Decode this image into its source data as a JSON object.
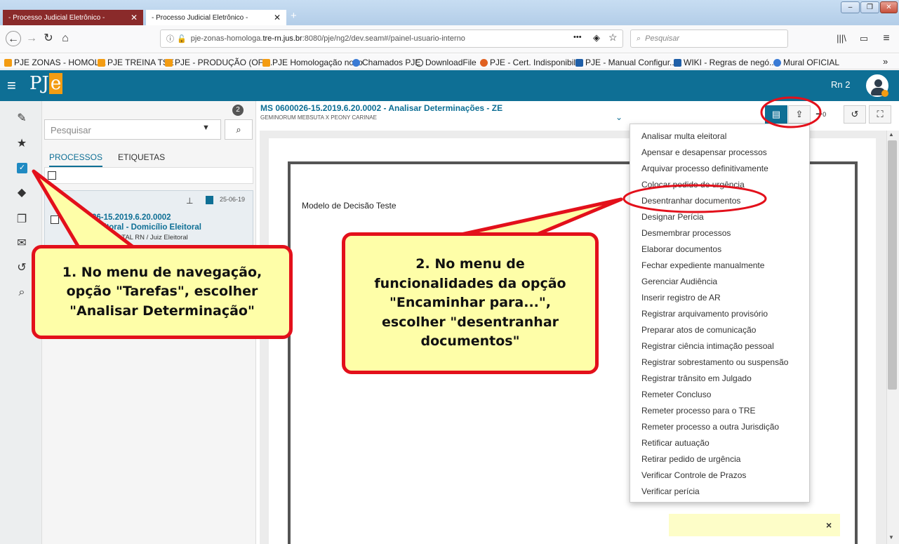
{
  "browser": {
    "tabs": [
      {
        "label": "- Processo Judicial Eletrônico -",
        "active": false
      },
      {
        "label": "- Processo Judicial Eletrônico -",
        "active": true
      }
    ],
    "url_prefix": "pje-zonas-homologa.",
    "url_domain": "tre-rn.jus.br",
    "url_suffix": ":8080/pje/ng2/dev.seam#/painel-usuario-interno",
    "search_placeholder": "Pesquisar",
    "more_dots": "•••",
    "bookmarks": [
      "PJE ZONAS - HOMOL...",
      "PJE TREINA TSE",
      "PJE - PRODUÇÃO (OFI...",
      "PJE Homologação novo",
      "Chamados PJE",
      "DownloadFile",
      "PJE - Cert. Indisponibil...",
      "PJE - Manual Configur...",
      "WIKI - Regras de negó...",
      "Mural OFICIAL"
    ],
    "bookmarks_overflow": "»"
  },
  "app": {
    "logo_pj": "PJ",
    "logo_e": "e",
    "user_name": "Rn 2"
  },
  "process_panel": {
    "badge": "2",
    "search_placeholder": "Pesquisar",
    "tabs": [
      "PROCESSOS",
      "ETIQUETAS"
    ],
    "item": {
      "date": "25-06-19",
      "number": "MS 0600026-15.2019.6.20.0002",
      "number_visible": "26-15.2019.6.20.0002",
      "class_visible": "Eleitoral - Domicílio Eleitoral",
      "orgao_visible": "AL DE NATAL RN / Juiz Eleitoral"
    }
  },
  "task": {
    "title": "MS 0600026-15.2019.6.20.0002 - Analisar Determinações - ZE",
    "subtitle": "GEMINORUM MEBSUTA X PEONY CARINAE",
    "count": "0"
  },
  "document": {
    "text": "Modelo de Decisão Teste",
    "close": "×"
  },
  "menu": {
    "items": [
      "Analisar multa eleitoral",
      "Apensar e desapensar processos",
      "Arquivar processo definitivamente",
      "Colocar pedido de urgência",
      "Desentranhar documentos",
      "Designar Perícia",
      "Desmembrar processos",
      "Elaborar documentos",
      "Fechar expediente manualmente",
      "Gerenciar Audiência",
      "Inserir registro de AR",
      "Registrar arquivamento provisório",
      "Preparar atos de comunicação",
      "Registrar ciência intimação pessoal",
      "Registrar sobrestamento ou suspensão",
      "Registrar trânsito em Julgado",
      "Remeter Concluso",
      "Remeter processo para o TRE",
      "Remeter processo a outra Jurisdição",
      "Retificar autuação",
      "Retirar pedido de urgência",
      "Verificar Controle de Prazos",
      "Verificar perícia"
    ]
  },
  "callouts": {
    "one": [
      "1. No menu de navegação,",
      "opção \"Tarefas\", escolher",
      "\"Analisar Determinação\""
    ],
    "two": [
      "2. No menu de",
      "funcionalidades da opção",
      "\"Encaminhar para...\",",
      "escolher \"desentranhar",
      "documentos\""
    ]
  },
  "colors": {
    "header": "#0e6f95",
    "accent": "#f39c12",
    "callout_fill": "#fefea8",
    "callout_border": "#e3101b"
  }
}
